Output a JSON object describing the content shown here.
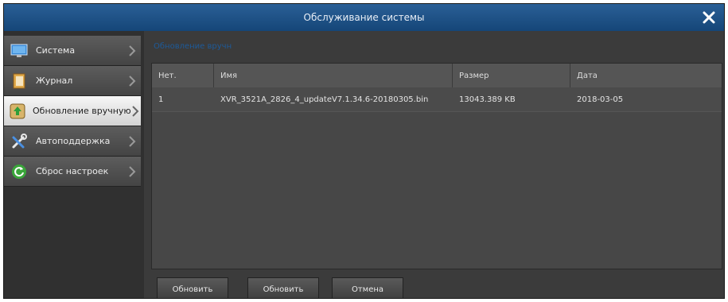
{
  "window": {
    "title": "Обслуживание системы",
    "close_icon": "close-icon"
  },
  "sidebar": {
    "items": [
      {
        "label": "Система",
        "icon": "system-monitor-icon",
        "active": false
      },
      {
        "label": "Журнал",
        "icon": "journal-book-icon",
        "active": false
      },
      {
        "label": "Обновление вручную",
        "icon": "upload-update-icon",
        "active": true
      },
      {
        "label": "Автоподдержка",
        "icon": "tools-wrench-icon",
        "active": false
      },
      {
        "label": "Сброс настроек",
        "icon": "reset-refresh-icon",
        "active": false
      }
    ]
  },
  "main": {
    "section_title": "Обновление вручн",
    "table": {
      "headers": [
        "Нет.",
        "Имя",
        "Размер",
        "Дата"
      ],
      "rows": [
        [
          "1",
          "XVR_3521A_2826_4_updateV7.1.34.6-20180305.bin",
          "13043.389 KB",
          "2018-03-05"
        ]
      ]
    },
    "buttons": [
      "Обновить",
      "Обновить",
      "Отмена"
    ]
  },
  "colors": {
    "titlebar": "#1f5186",
    "panel_bg": "#3b3b3b",
    "active_item": "#e8e8e8",
    "section_title": "#1e5a98"
  }
}
